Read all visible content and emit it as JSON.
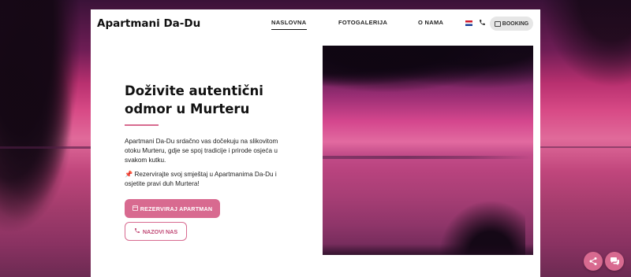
{
  "header": {
    "logo": "Apartmani Da-Du",
    "nav": [
      {
        "label": "NASLOVNA",
        "active": true
      },
      {
        "label": "FOTOGALERIJA",
        "active": false
      },
      {
        "label": "O NAMA",
        "active": false
      }
    ],
    "booking_label": "BOOKING"
  },
  "hero": {
    "heading": "Doživite autentični odmor u Murteru",
    "paragraph1": "Apartmani Da-Du srdačno vas dočekuju na slikovitom otoku Murteru, gdje se spoj tradicije i prirode osjeća u svakom kutku.",
    "paragraph2": "📌 Rezervirajte svoj smještaj u Apartmanima Da-Du i osjetite pravi duh Murtera!",
    "primary_button": "REZERVIRAJ APARTMAN",
    "secondary_button": "NAZOVI NAS"
  },
  "icons": {
    "flag": "croatia-flag-icon",
    "phone": "phone-icon",
    "booking": "calendar-icon",
    "reserve": "calendar-icon",
    "call": "phone-icon",
    "share": "share-icon",
    "chat": "chat-icon"
  },
  "colors": {
    "accent": "#d86a90",
    "text": "#111111",
    "card_bg": "#ffffff"
  }
}
